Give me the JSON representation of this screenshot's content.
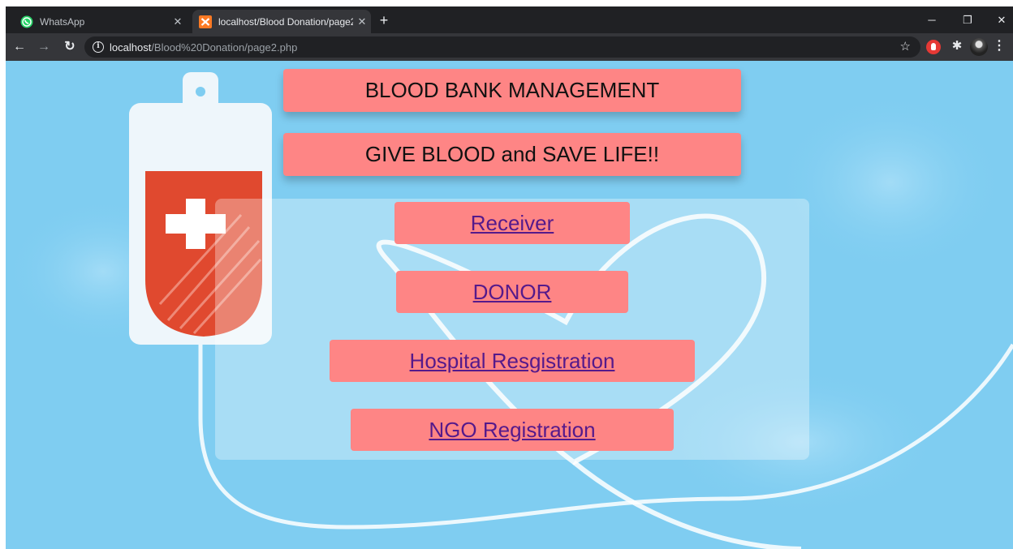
{
  "browser": {
    "tabs": [
      {
        "title": "WhatsApp",
        "icon": "whatsapp-icon"
      },
      {
        "title": "localhost/Blood Donation/page2",
        "icon": "xampp-icon",
        "active": true
      }
    ],
    "new_tab_label": "+",
    "url_host": "localhost",
    "url_path": "/Blood%20Donation/page2.php"
  },
  "page": {
    "title": "BLOOD BANK MANAGEMENT",
    "slogan": "GIVE BLOOD and SAVE LIFE!!",
    "links": [
      {
        "label": "Receiver"
      },
      {
        "label": "DONOR"
      },
      {
        "label": "Hospital Resgistration"
      },
      {
        "label": "NGO Registration"
      }
    ]
  },
  "colors": {
    "background": "#7fcdf1",
    "button": "#fe8585",
    "link_text": "#551a8b",
    "blood_bag_red": "#e0492f"
  }
}
